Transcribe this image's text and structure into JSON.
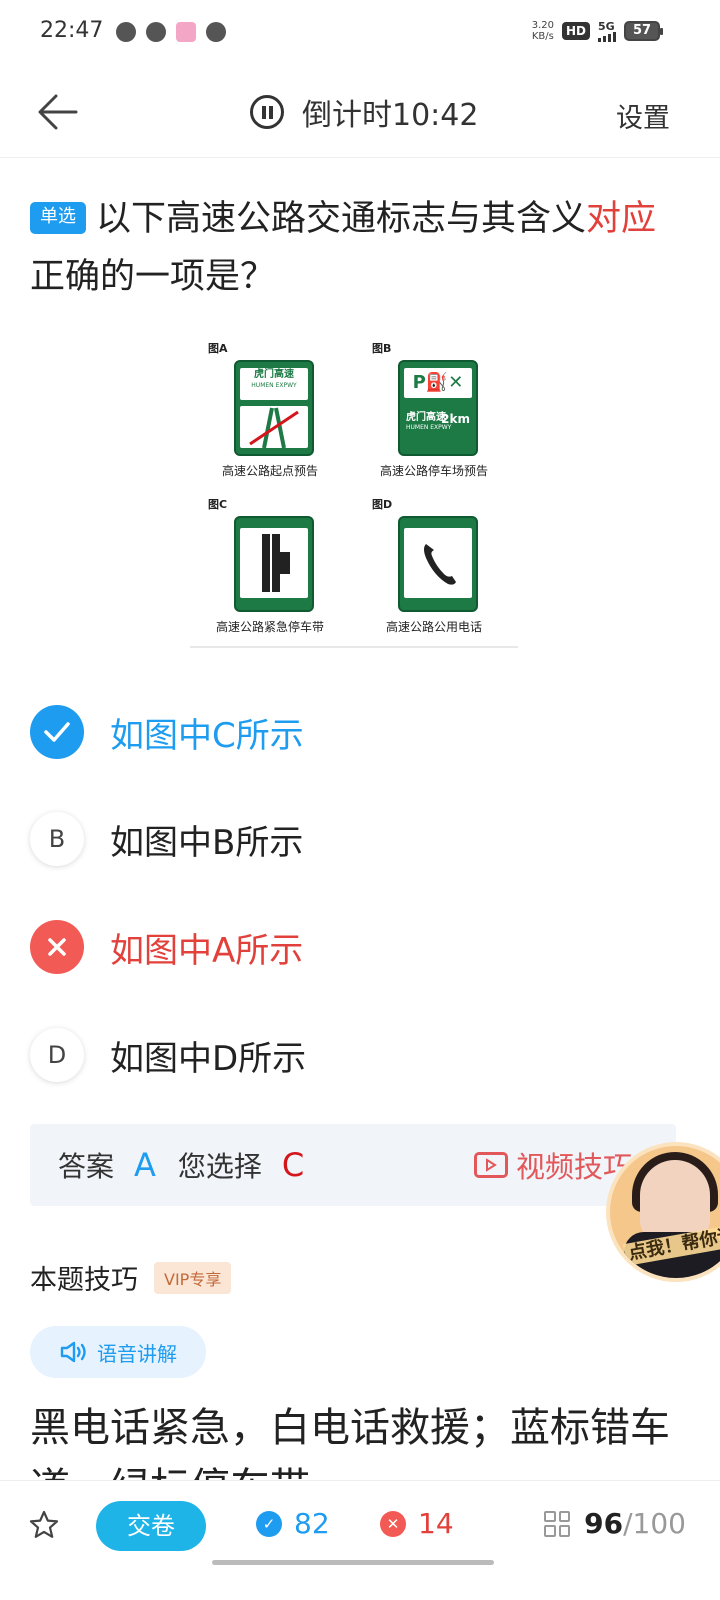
{
  "status": {
    "time": "22:47",
    "net_speed_value": "3.20",
    "net_speed_unit": "KB/s",
    "hd": "HD",
    "network": "5G",
    "battery": "57"
  },
  "nav": {
    "timer_label": "倒计时10:42",
    "settings_label": "设置"
  },
  "question": {
    "type_badge": "单选",
    "text_part1": "以下高速公路交通标志与其含义",
    "text_highlight": "对应",
    "text_part2": "正确的一项是？"
  },
  "figure": {
    "cells": [
      {
        "label": "图A",
        "caption": "高速公路起点预告",
        "sign_title": "虎门高速",
        "sign_sub": "HUMEN EXPWY"
      },
      {
        "label": "图B",
        "caption": "高速公路停车场预告",
        "sign_title": "虎门高速",
        "sign_sub": "HUMEN EXPWY",
        "sign_symbols": "P⛽✕",
        "sign_distance": "2km"
      },
      {
        "label": "图C",
        "caption": "高速公路紧急停车带"
      },
      {
        "label": "图D",
        "caption": "高速公路公用电话"
      }
    ]
  },
  "options": [
    {
      "marker": "✓",
      "text": "如图中C所示",
      "state": "selected"
    },
    {
      "marker": "B",
      "text": "如图中B所示",
      "state": "normal"
    },
    {
      "marker": "✕",
      "text": "如图中A所示",
      "state": "wrong"
    },
    {
      "marker": "D",
      "text": "如图中D所示",
      "state": "normal"
    }
  ],
  "answer": {
    "answer_label": "答案",
    "answer_value": "A",
    "chosen_label": "您选择",
    "chosen_value": "C",
    "video_tip_label": "视频技巧"
  },
  "avatar": {
    "cta": "点我！帮你讲"
  },
  "tips": {
    "title": "本题技巧",
    "vip_badge": "VIP专享",
    "voice_label": "语音讲解",
    "text": "黑电话紧急，白电话救援；蓝标错车道，绿标停车带"
  },
  "bottom": {
    "submit_label": "交卷",
    "correct_count": "82",
    "wrong_count": "14",
    "progress_current": "96",
    "progress_total": "/100"
  },
  "colors": {
    "accent_blue": "#1e9cf0",
    "error_red": "#e2403b",
    "sign_green": "#1d7a45"
  }
}
